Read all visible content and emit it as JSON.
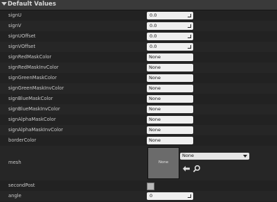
{
  "section": {
    "title": "Default Values"
  },
  "rows": [
    {
      "label": "signU",
      "value": "0.0"
    },
    {
      "label": "signV",
      "value": "0.0"
    },
    {
      "label": "signUOffset",
      "value": "0.0"
    },
    {
      "label": "signVOffset",
      "value": "0.0"
    },
    {
      "label": "signRedMaskColor",
      "value": "None"
    },
    {
      "label": "signRedMaskInvColor",
      "value": "None"
    },
    {
      "label": "signGreenMaskColor",
      "value": "None"
    },
    {
      "label": "signGreenMaskInvColor",
      "value": "None"
    },
    {
      "label": "signBlueMaskColor",
      "value": "None"
    },
    {
      "label": "signBlueMaskInvColor",
      "value": "None"
    },
    {
      "label": "signAlphaMaskColor",
      "value": "None"
    },
    {
      "label": "signAlphaMaskInvColor",
      "value": "None"
    },
    {
      "label": "borderColor",
      "value": "None"
    }
  ],
  "mesh": {
    "label": "mesh",
    "thumbnail_text": "None",
    "selected": "None"
  },
  "secondPost": {
    "label": "secondPost"
  },
  "angle": {
    "label": "angle",
    "value": "0"
  },
  "icons": {
    "use": "arrow-left-icon",
    "browse": "magnifier-icon"
  }
}
